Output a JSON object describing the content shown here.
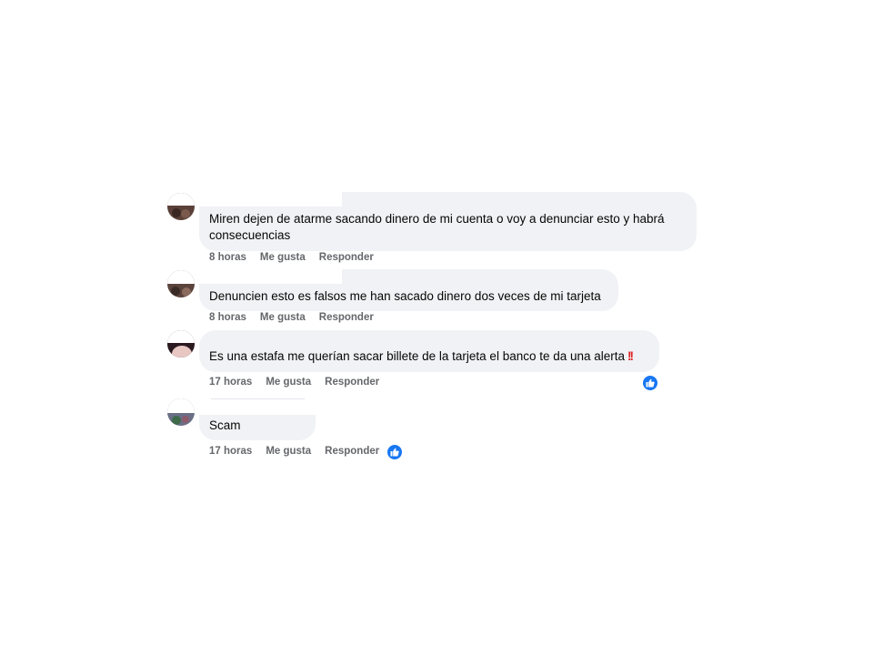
{
  "comments": [
    {
      "text": "Miren dejen de atarme sacando dinero de mi cuenta o voy a denunciar esto y habrá consecuencias",
      "time": "8 horas",
      "like_label": "Me gusta",
      "reply_label": "Responder",
      "reaction_icon": null
    },
    {
      "text": "Denuncien esto es falsos me han sacado dinero dos veces de mi tarjeta",
      "time": "8 horas",
      "like_label": "Me gusta",
      "reply_label": "Responder",
      "reaction_icon": null
    },
    {
      "text": "Es una estafa me querían sacar billete de la tarjeta el banco te da una alerta",
      "emoji": "!!",
      "time": "17 horas",
      "like_label": "Me gusta",
      "reply_label": "Responder",
      "reaction_icon": "thumbs-up-icon"
    },
    {
      "text": "Scam",
      "time": "17 horas",
      "like_label": "Me gusta",
      "reply_label": "Responder",
      "reaction_icon": "thumbs-up-icon"
    }
  ],
  "colors": {
    "bubble": "#f0f2f5",
    "meta_text": "#65676b",
    "like_blue": "#1877f2",
    "emoji_red": "#e02424"
  }
}
